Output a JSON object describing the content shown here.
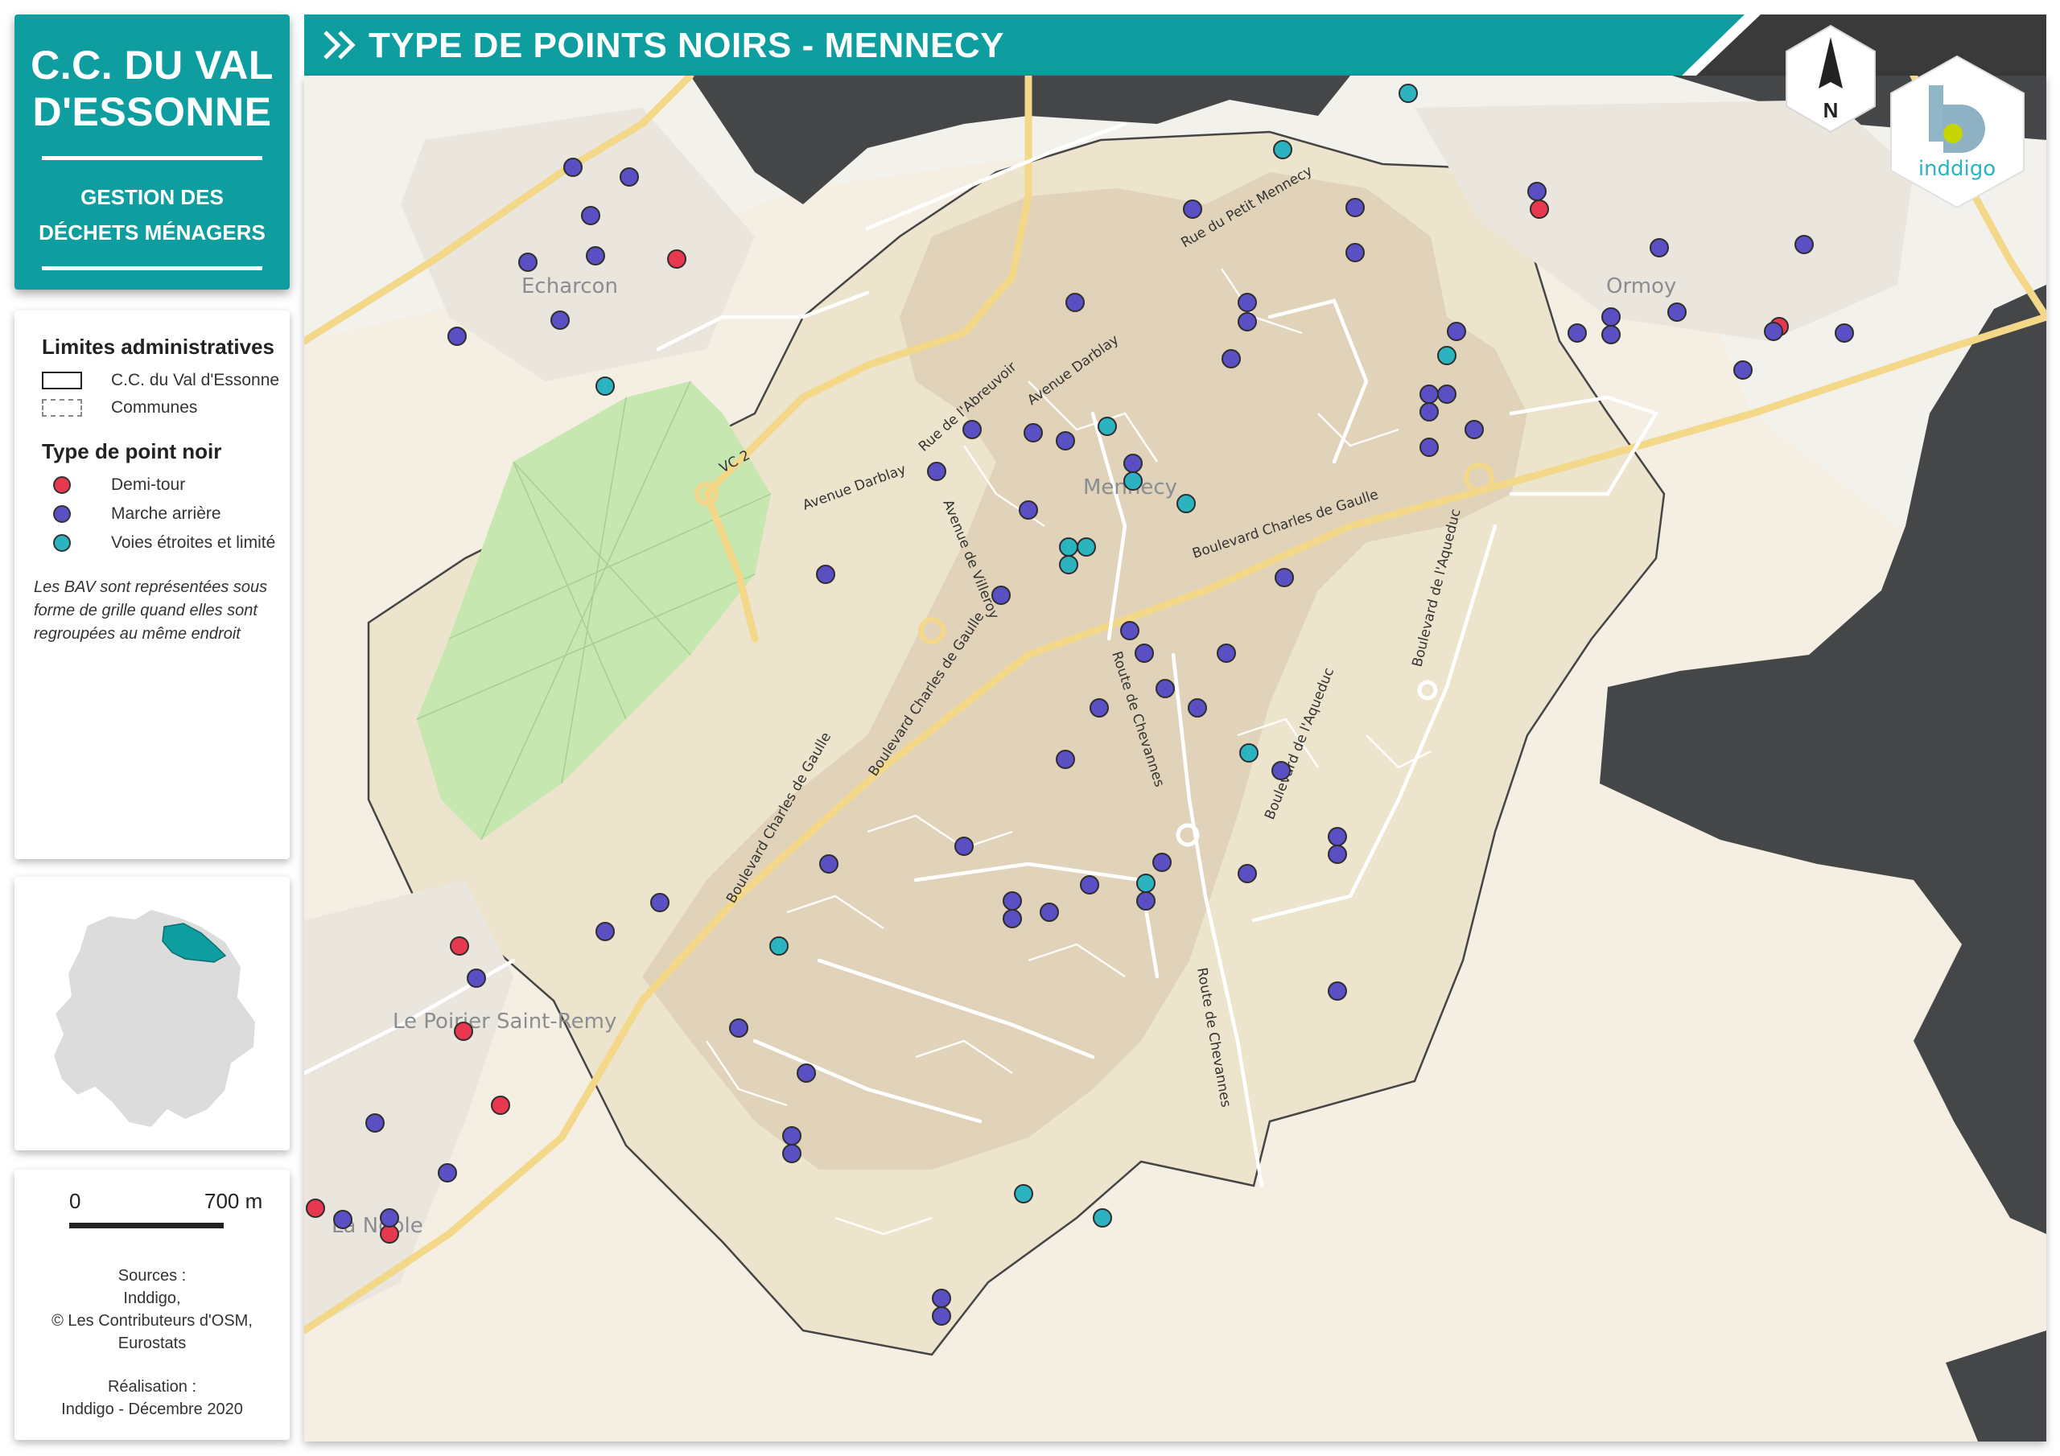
{
  "title_block": {
    "organization_line1": "C.C. DU VAL",
    "organization_line2": "D'ESSONNE",
    "subtitle_line1": "GESTION DES",
    "subtitle_line2": "DÉCHETS MÉNAGERS"
  },
  "header": {
    "title": "TYPE DE POINTS NOIRS - MENNECY",
    "bar_color": "#0e9e9f",
    "dark_color": "#3a3a3a"
  },
  "legend": {
    "admin_heading": "Limites administratives",
    "admin_items": [
      {
        "label": "C.C. du Val d'Essonne",
        "style": "solid"
      },
      {
        "label": "Communes",
        "style": "dashed"
      }
    ],
    "type_heading": "Type de point noir",
    "type_items": [
      {
        "label": "Demi-tour",
        "color": "#e8384f"
      },
      {
        "label": "Marche arrière",
        "color": "#5b4fc4"
      },
      {
        "label": "Voies étroites et limité",
        "color": "#2bb3c0"
      }
    ],
    "note": "Les BAV sont représentées sous forme de grille quand elles sont regroupées au même endroit"
  },
  "scale": {
    "start": "0",
    "end": "700 m"
  },
  "sources": {
    "heading": "Sources :",
    "line1": "Inddigo,",
    "line2": "© Les Contributeurs d'OSM,",
    "line3": "Eurostats",
    "credit_heading": "Réalisation :",
    "credit": "Inddigo - Décembre 2020"
  },
  "north_arrow": {
    "letter": "N"
  },
  "logo": {
    "name": "inddigo",
    "accent": "#c8d400",
    "brand": "#2bb3c0"
  },
  "map": {
    "place_labels": {
      "echarcon": "Echarcon",
      "mennecy": "Mennecy",
      "ormoy": "Ormoy",
      "poirier": "Le Poirier Saint-Remy",
      "noblesse": "La Noble"
    },
    "road_labels": {
      "petit_mennecy": "Rue du Petit Mennecy",
      "darblay_n": "Avenue Darblay",
      "abreuvoir": "Rue de l'Abreuvoir",
      "vc2": "VC 2",
      "darblay_w": "Avenue Darblay",
      "villeroy": "Avenue de Villeroy",
      "cdg_e": "Boulevard Charles de Gaulle",
      "cdg_mid": "Boulevard Charles de Gaulle",
      "cdg_sw": "Boulevard Charles de Gaulle",
      "chevannes_n": "Route de Chevannes",
      "chevannes_s": "Route de Chevannes",
      "aqueduc_e": "Boulevard de l'Aqueduc",
      "aqueduc_s": "Boulevard de l'Aqueduc"
    }
  }
}
